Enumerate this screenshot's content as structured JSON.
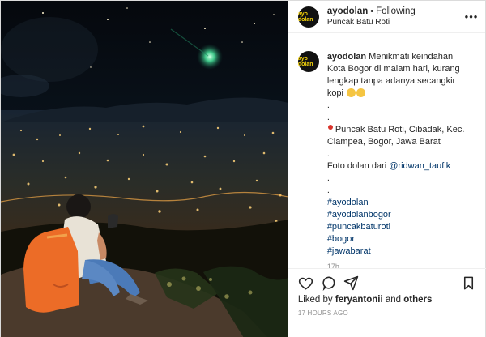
{
  "account": {
    "username": "ayodolan",
    "separator": "•",
    "follow_state": "Following",
    "location": "Puncak Batu Roti",
    "avatar_text": "ayo dolan"
  },
  "caption": {
    "username": "ayodolan",
    "lines": [
      "Menikmati keindahan",
      "Kota Bogor di malam hari, kurang",
      "lengkap tanpa adanya secangkir",
      "kopi",
      ".",
      ".",
      "Puncak Batu Roti, Cibadak, Kec.",
      "Ciampea, Bogor, Jawa Barat",
      ".",
      "Foto dolan dari",
      "@ridwan_taufik",
      ".",
      ".",
      "#ayodolan",
      "#ayodolanbogor",
      "#puncakbaturoti",
      "#bogor",
      "#jawabarat"
    ],
    "comment_time": "17h"
  },
  "engagement": {
    "liked_by_prefix": "Liked by",
    "liked_by_user": "feryantonii",
    "liked_by_suffix": "and",
    "liked_by_others": "others",
    "posted_ago": "17 HOURS AGO"
  },
  "icons": [
    "more-options-icon",
    "heart-icon",
    "comment-icon",
    "share-icon",
    "bookmark-icon",
    "location-pin-icon",
    "grin-emoji-icon"
  ],
  "colors": {
    "text": "#262626",
    "muted": "#8e8e8e",
    "link": "#003569",
    "border": "#dbdbdb",
    "accent_avatar": "#f6d40a"
  }
}
